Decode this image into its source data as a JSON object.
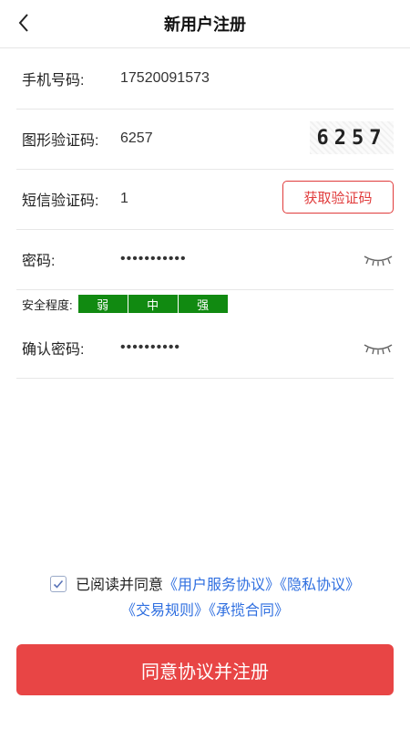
{
  "header": {
    "title": "新用户注册"
  },
  "form": {
    "phone": {
      "label": "手机号码:",
      "value": "17520091573"
    },
    "graphic_code": {
      "label": "图形验证码:",
      "value": "6257",
      "captcha_text": "6257"
    },
    "sms_code": {
      "label": "短信验证码:",
      "value": "1",
      "button": "获取验证码"
    },
    "password": {
      "label": "密码:",
      "masked": "•••••••••••"
    },
    "strength": {
      "label": "安全程度:",
      "levels": [
        "弱",
        "中",
        "强"
      ],
      "color": "#118a11"
    },
    "confirm_password": {
      "label": "确认密码:",
      "masked": "••••••••••"
    }
  },
  "agreement": {
    "prefix": "已阅读并同意",
    "links": [
      "《用户服务协议》",
      "《隐私协议》",
      "《交易规则》",
      "《承揽合同》"
    ],
    "checked": true
  },
  "submit": {
    "label": "同意协议并注册",
    "color": "#e84545"
  },
  "icons": {
    "back": "back-arrow-icon",
    "eye": "eye-closed-icon",
    "check": "check-icon"
  }
}
